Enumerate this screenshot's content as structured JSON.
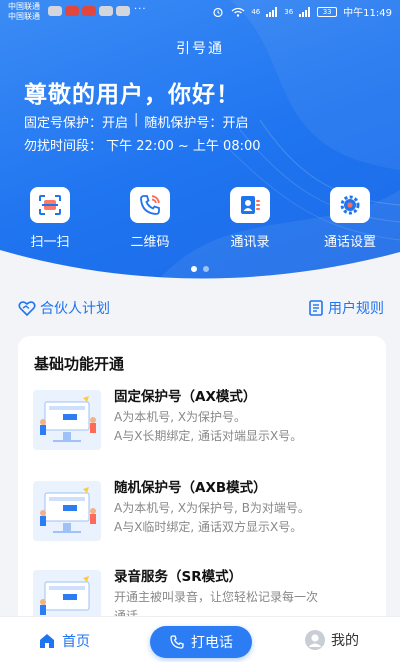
{
  "statusbar": {
    "carrier1": "中国联通",
    "carrier2": "中国联通",
    "dots": "···",
    "signal": "46",
    "signal2": "36",
    "battery": "33",
    "time": "中午11:49"
  },
  "app": {
    "title": "引号通"
  },
  "hero": {
    "greeting": "尊敬的用户，你好！",
    "fixed_protect_label": "固定号保护：",
    "fixed_protect_value": "开启",
    "separator": "|",
    "random_protect_label": "随机保护号：",
    "random_protect_value": "开启",
    "dnd_label": "勿扰时间段：",
    "dnd_value": "下午 22:00 ~ 上午 08:00"
  },
  "actions": [
    {
      "label": "扫一扫",
      "icon": "scan-icon"
    },
    {
      "label": "二维码",
      "icon": "phone-icon"
    },
    {
      "label": "通讯录",
      "icon": "contacts-icon"
    },
    {
      "label": "通话设置",
      "icon": "gear-icon"
    }
  ],
  "links": {
    "partner": "合伙人计划",
    "rules": "用户规则"
  },
  "card": {
    "title": "基础功能开通",
    "features": [
      {
        "title": "固定保护号（AX模式）",
        "desc1": "A为本机号, X为保护号。",
        "desc2": " A与X长期绑定, 通话对端显示X号。"
      },
      {
        "title": "随机保护号（AXB模式）",
        "desc1": "A为本机号, X为保护号, B为对端号。",
        "desc2": "A与X临时绑定, 通话双方显示X号。"
      },
      {
        "title": "录音服务（SR模式）",
        "desc1": "开通主被叫录音，让您轻松记录每一次",
        "desc2": "通话"
      }
    ]
  },
  "nav": {
    "home": "首页",
    "call": "打电话",
    "me": "我的"
  },
  "colors": {
    "primary": "#1f74f0",
    "hero_top": "#3c8cf5",
    "background": "#f2f4f8"
  }
}
